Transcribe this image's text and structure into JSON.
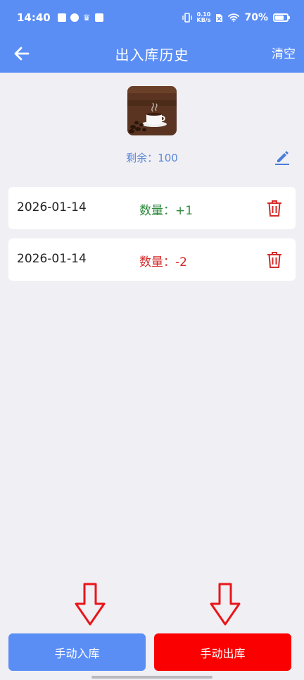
{
  "status_bar": {
    "time": "14:40",
    "net_speed_value": "0.10",
    "net_speed_unit": "KB/s",
    "battery": "70%"
  },
  "app_bar": {
    "title": "出入库历史",
    "clear_label": "清空"
  },
  "product": {
    "remaining": "剩余：100"
  },
  "records": [
    {
      "date": "2026-01-14",
      "quantity": "数量：+1"
    },
    {
      "date": "2026-01-14",
      "quantity": "数量：-2"
    }
  ],
  "actions": {
    "stock_in_label": "手动入库",
    "stock_out_label": "手动出库"
  },
  "colors": {
    "primary": "#5b8ef5",
    "danger": "#fb0000",
    "plus": "#2e8b3e",
    "minus": "#d42a2a"
  }
}
